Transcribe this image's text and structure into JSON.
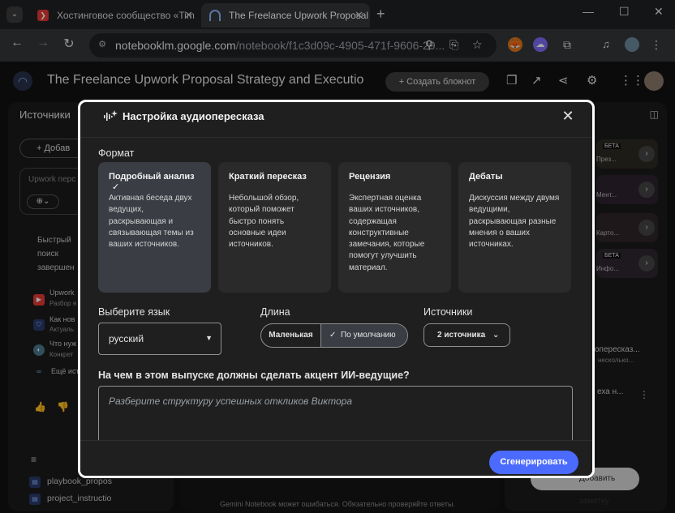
{
  "browser": {
    "tabs": [
      {
        "title": "Хостинговое сообщество «Tim",
        "icon": "timeweb-icon"
      },
      {
        "title": "The Freelance Upwork Proposal",
        "icon": "notebooklm-icon"
      }
    ],
    "url_host": "notebooklm.google.com",
    "url_path": "/notebook/f1c3d09c-4905-471f-9606-29..."
  },
  "app": {
    "notebook_title": "The Freelance Upwork Proposal Strategy and Execution Pl",
    "create_notebook": "Создать блокнот",
    "sources_header": "Источники",
    "add_source": "Добав",
    "search_placeholder": "Upwork перс",
    "left_card_title": [
      "Быстрый",
      "поиск",
      "завершен"
    ],
    "left_sources": [
      {
        "title": "Upwork",
        "sub": "Разбор я"
      },
      {
        "title": "Как нов",
        "sub": "Актуаль"
      },
      {
        "title": "Что нуж",
        "sub": "Конкрет"
      },
      {
        "title": "Ещё ист",
        "sub": ""
      }
    ],
    "files": [
      "playbook_propos",
      "project_instructio"
    ],
    "right_cards": [
      {
        "badge": "БЕТА",
        "label": "През..."
      },
      {
        "badge": "",
        "label": "Мент..."
      },
      {
        "badge": "",
        "label": "Карто..."
      },
      {
        "badge": "БЕТА",
        "label": "Инфо..."
      }
    ],
    "right_items": [
      "опересказ...",
      "несколько...",
      "еха н..."
    ],
    "add_note": "Добавить заметку",
    "footer": "Gemini Notebook может ошибаться. Обязательно проверяйте ответы."
  },
  "dialog": {
    "title": "Настройка аудиопересказа",
    "format_label": "Формат",
    "formats": [
      {
        "title": "Подробный анализ",
        "desc": "Активная беседа двух ведущих, раскрывающая и связывающая темы из ваших источников.",
        "selected": true
      },
      {
        "title": "Краткий пересказ",
        "desc": "Небольшой обзор, который поможет быстро понять основные идеи источников.",
        "selected": false
      },
      {
        "title": "Рецензия",
        "desc": "Экспертная оценка ваших источников, содержащая конструктивные замечания, которые помогут улучшить материал.",
        "selected": false
      },
      {
        "title": "Дебаты",
        "desc": "Дискуссия между двумя ведущими, раскрывающая разные мнения о ваших источниках.",
        "selected": false
      }
    ],
    "language_label": "Выберите язык",
    "language_value": "русский",
    "length_label": "Длина",
    "length_short": "Маленькая",
    "length_default": "По умолчанию",
    "sources_label": "Источники",
    "sources_value": "2 источника",
    "focus_question": "На чем в этом выпуске должны сделать акцент ИИ-ведущие?",
    "focus_placeholder": "Разберите структуру успешных откликов Виктора",
    "generate": "Сгенерировать"
  }
}
